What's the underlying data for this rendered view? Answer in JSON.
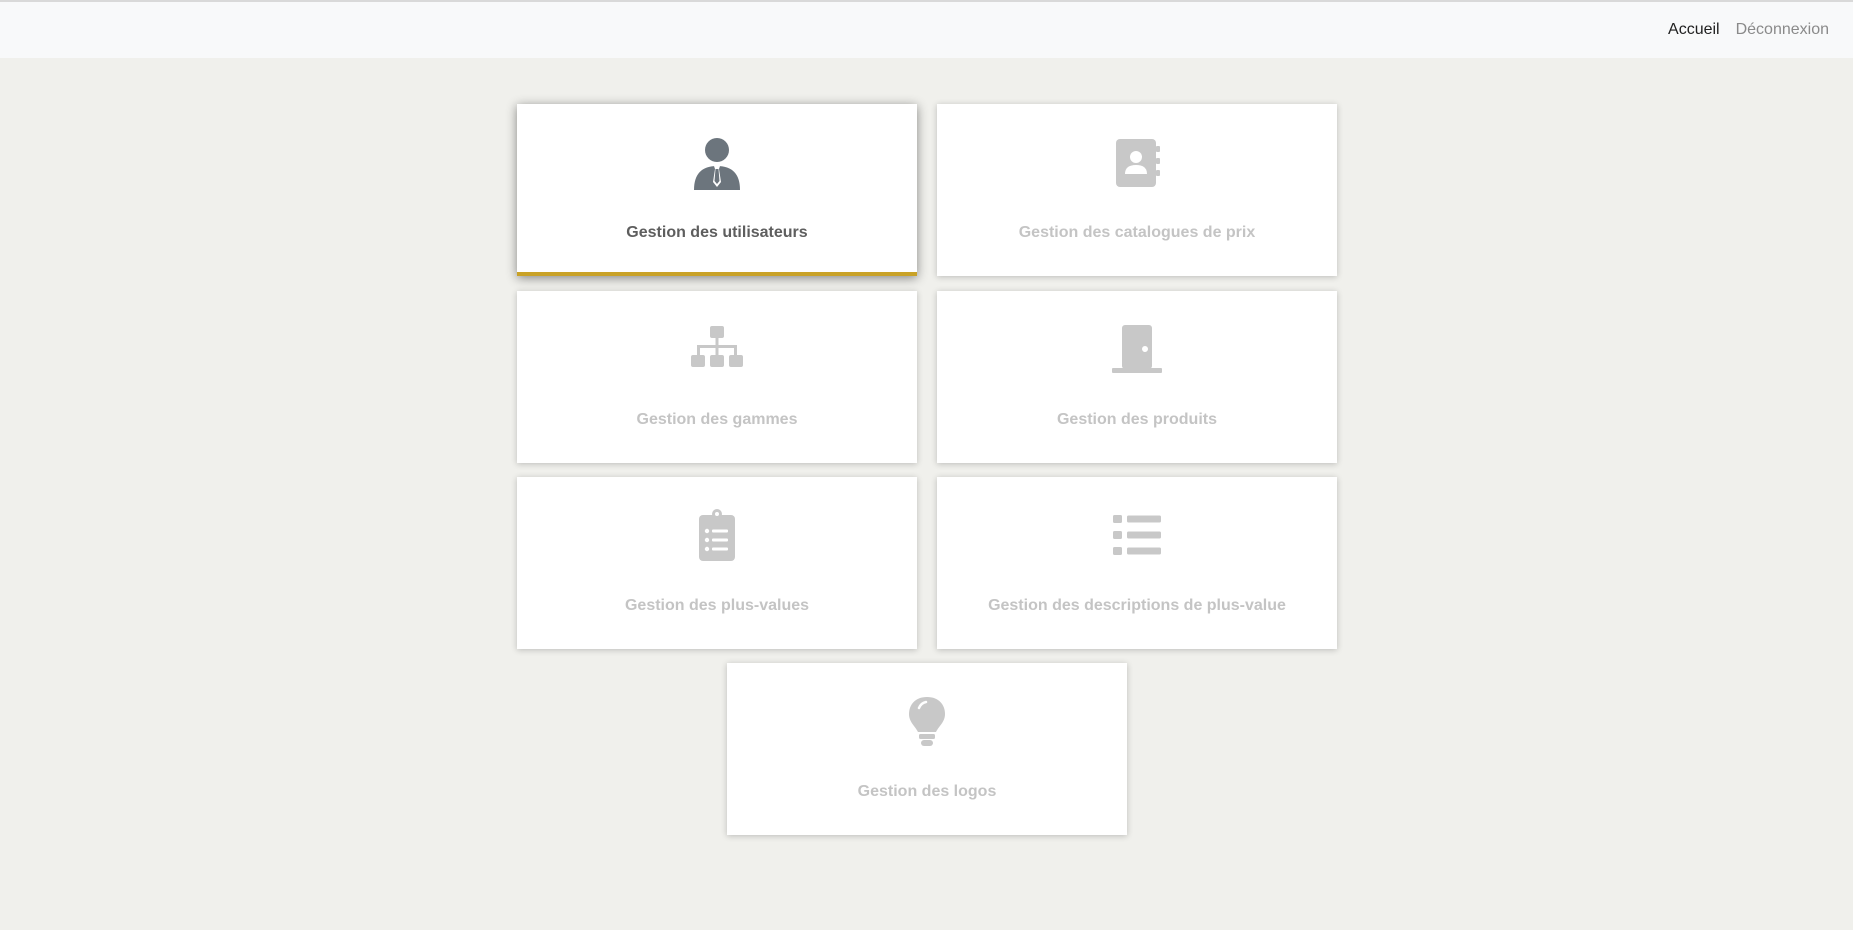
{
  "nav": {
    "home": "Accueil",
    "logout": "Déconnexion"
  },
  "colors": {
    "accent": "#c9a227",
    "active_icon": "#6c757d",
    "inactive_icon": "#c8c8c8",
    "page_background": "#f0f0ec"
  },
  "tiles": [
    {
      "label": "Gestion des utilisateurs",
      "icon": "user-tie-icon",
      "selected": true
    },
    {
      "label": "Gestion des catalogues de prix",
      "icon": "address-book-icon",
      "selected": false
    },
    {
      "label": "Gestion des gammes",
      "icon": "sitemap-icon",
      "selected": false
    },
    {
      "label": "Gestion des produits",
      "icon": "door-closed-icon",
      "selected": false
    },
    {
      "label": "Gestion des plus-values",
      "icon": "clipboard-list-icon",
      "selected": false
    },
    {
      "label": "Gestion des descriptions de plus-value",
      "icon": "list-icon",
      "selected": false
    },
    {
      "label": "Gestion des logos",
      "icon": "lightbulb-icon",
      "selected": false
    }
  ]
}
